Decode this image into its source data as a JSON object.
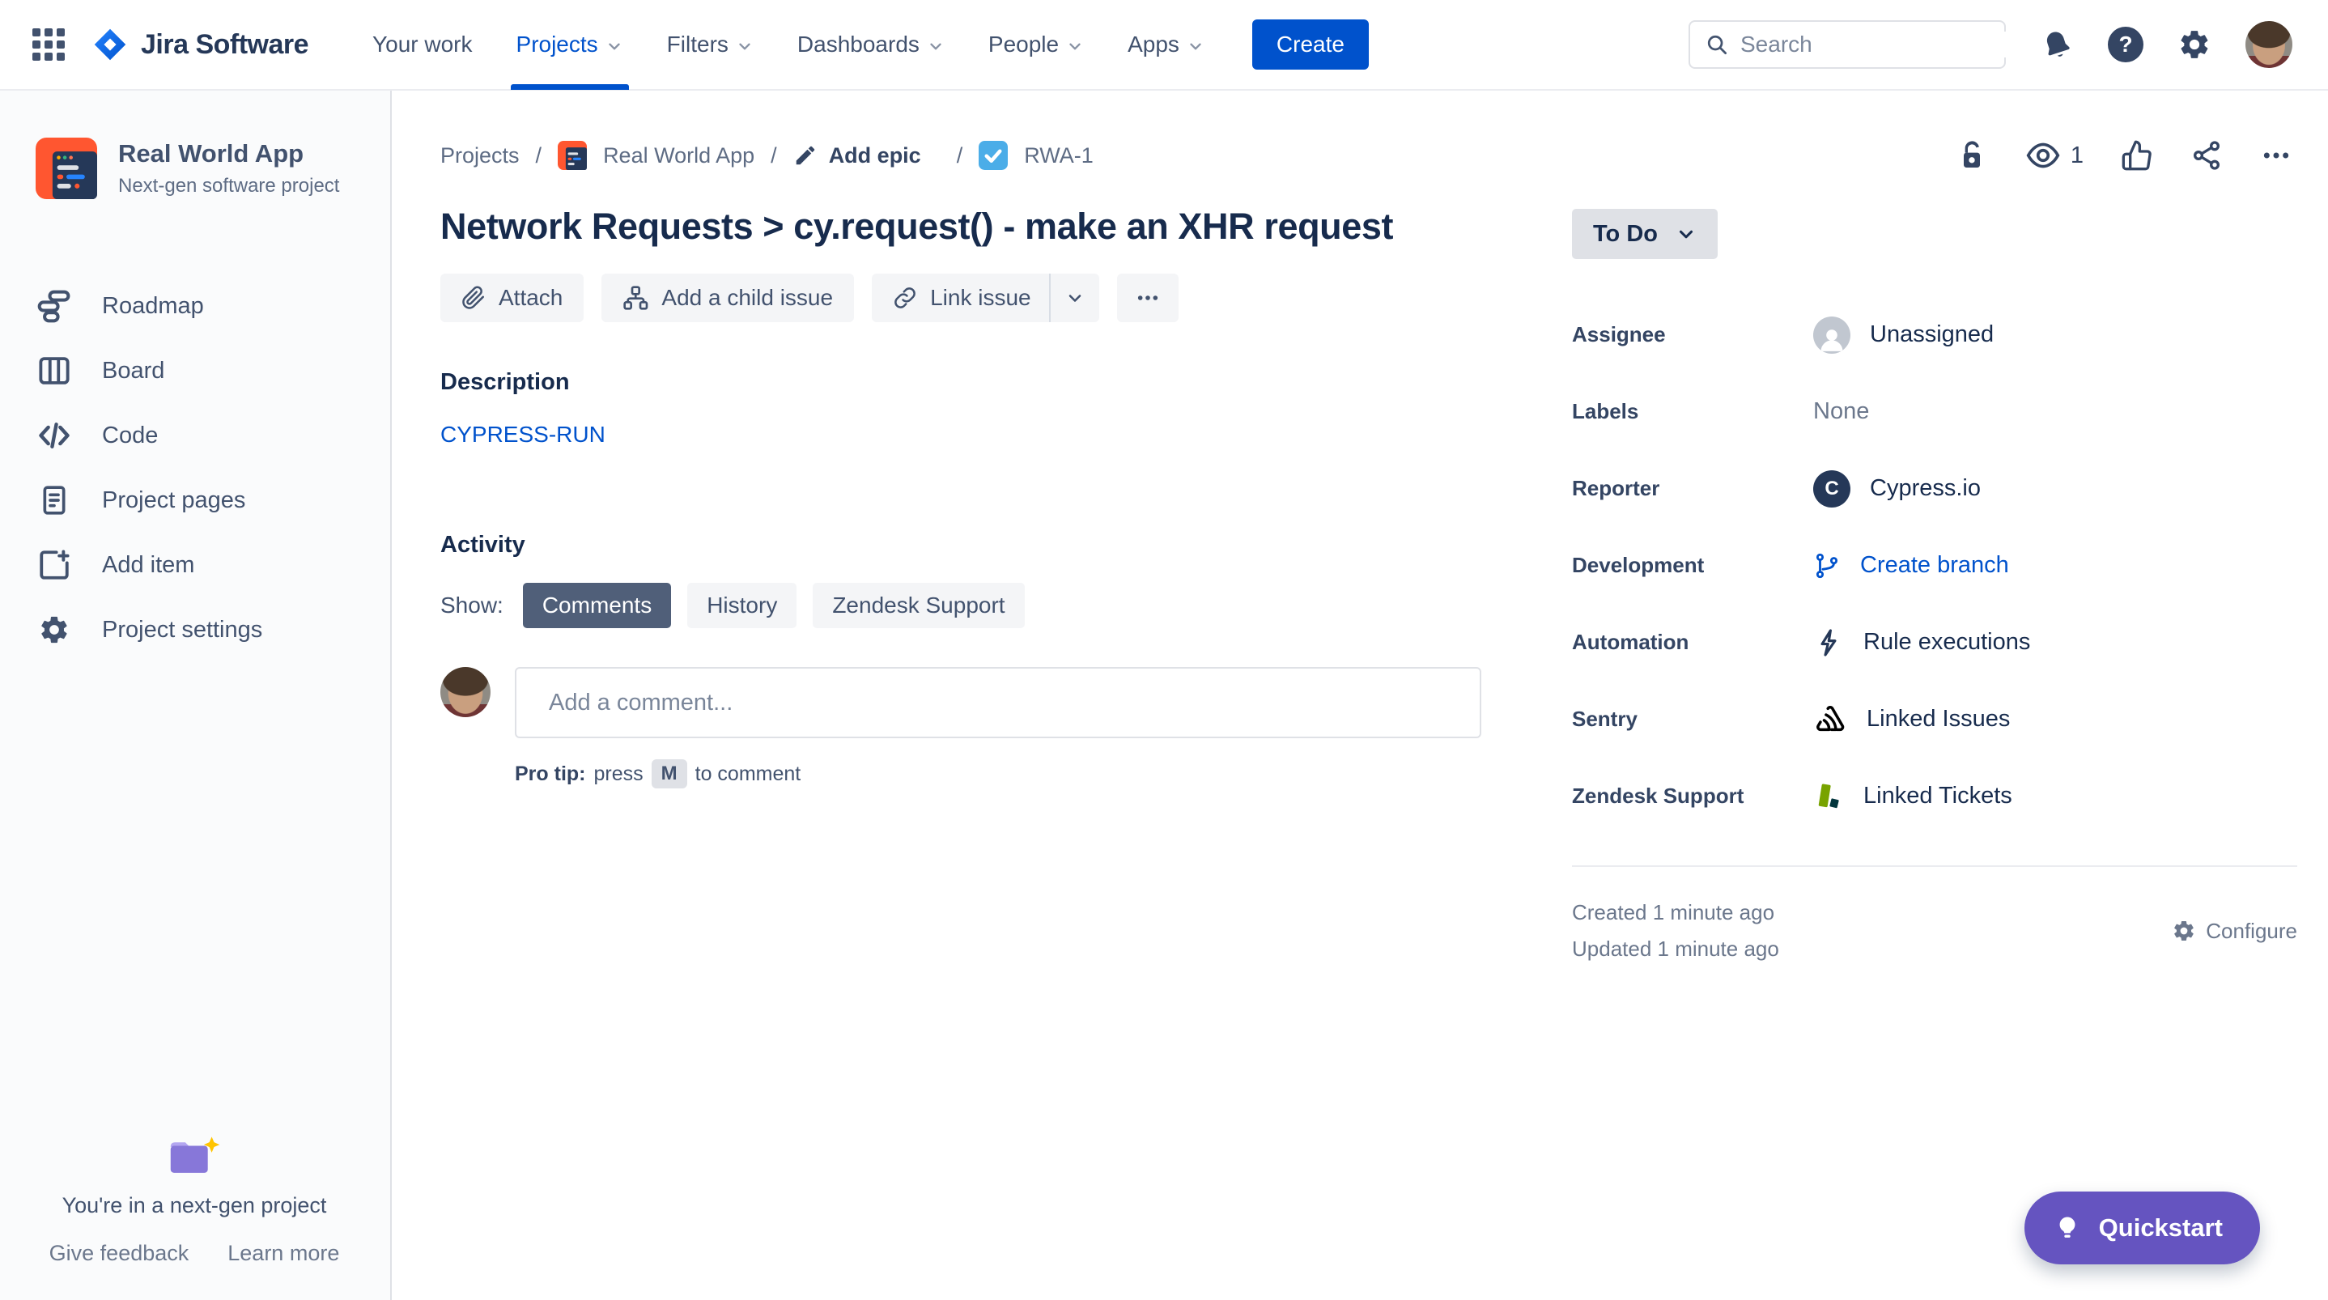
{
  "nav": {
    "brand": "Jira Software",
    "items": [
      {
        "label": "Your work",
        "active": false,
        "chevron": false
      },
      {
        "label": "Projects",
        "active": true,
        "chevron": true
      },
      {
        "label": "Filters",
        "active": false,
        "chevron": true
      },
      {
        "label": "Dashboards",
        "active": false,
        "chevron": true
      },
      {
        "label": "People",
        "active": false,
        "chevron": true
      },
      {
        "label": "Apps",
        "active": false,
        "chevron": true
      }
    ],
    "create_label": "Create",
    "search": {
      "placeholder": "Search"
    }
  },
  "sidebar": {
    "project": {
      "name": "Real World App",
      "type": "Next-gen software project"
    },
    "items": [
      {
        "label": "Roadmap"
      },
      {
        "label": "Board"
      },
      {
        "label": "Code"
      },
      {
        "label": "Project pages"
      },
      {
        "label": "Add item"
      },
      {
        "label": "Project settings"
      }
    ],
    "footer": {
      "message": "You're in a next-gen project",
      "feedback_label": "Give feedback",
      "learn_label": "Learn more"
    }
  },
  "breadcrumb": {
    "projects": "Projects",
    "project": "Real World App",
    "add_epic": "Add epic",
    "issue_key": "RWA-1"
  },
  "toolbar": {
    "watchers_count": "1"
  },
  "issue": {
    "title": "Network Requests > cy.request() - make an XHR request",
    "attach_label": "Attach",
    "child_label": "Add a child issue",
    "link_label": "Link issue",
    "description_label": "Description",
    "description_link": "CYPRESS-RUN",
    "activity": {
      "heading": "Activity",
      "show_label": "Show:",
      "filters": [
        {
          "label": "Comments",
          "selected": true
        },
        {
          "label": "History",
          "selected": false
        },
        {
          "label": "Zendesk Support",
          "selected": false
        }
      ],
      "comment_placeholder": "Add a comment...",
      "protip_bold": "Pro tip:",
      "protip_press": "press",
      "protip_key": "M",
      "protip_after": "to comment"
    }
  },
  "details": {
    "status": "To Do",
    "reporter_initial": "C",
    "fields": [
      {
        "label": "Assignee",
        "value": "Unassigned"
      },
      {
        "label": "Labels",
        "value": "None"
      },
      {
        "label": "Reporter",
        "value": "Cypress.io"
      },
      {
        "label": "Development",
        "value": "Create branch"
      },
      {
        "label": "Automation",
        "value": "Rule executions"
      },
      {
        "label": "Sentry",
        "value": "Linked Issues"
      },
      {
        "label": "Zendesk Support",
        "value": "Linked Tickets"
      }
    ],
    "created": "Created 1 minute ago",
    "updated": "Updated 1 minute ago",
    "configure_label": "Configure"
  },
  "quickstart_label": "Quickstart",
  "colors": {
    "accent_blue": "#0052CC",
    "text_dark": "#172B4D",
    "text_slate": "#42526E",
    "text_gray": "#5E6C84",
    "status_bg": "#DFE1E6",
    "selected_chip": "#505F79",
    "purple": "#6554C0",
    "task_icon_blue": "#4BADE8",
    "project_icon_orange": "#FF5630",
    "zendesk_green": "#78A300"
  }
}
